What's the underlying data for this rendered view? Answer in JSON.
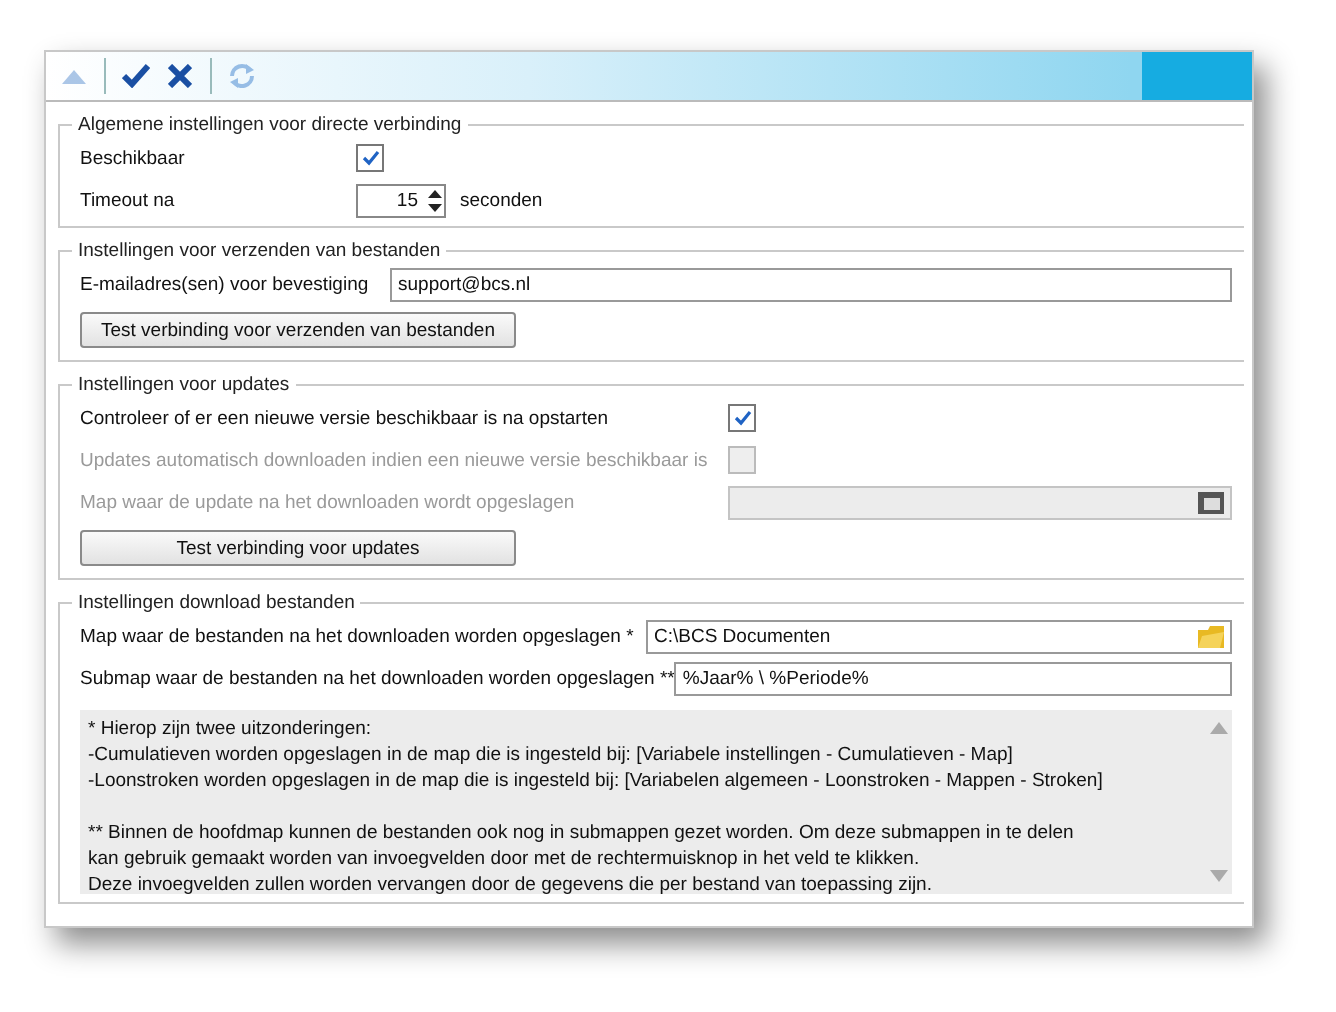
{
  "toolbar": {
    "buttons": [
      {
        "kind": "up",
        "disabled": true
      },
      {
        "kind": "save",
        "disabled": false
      },
      {
        "kind": "cancel",
        "disabled": false
      },
      {
        "kind": "refresh",
        "disabled": true
      }
    ]
  },
  "groups": [
    {
      "title": "Algemene instellingen voor directe verbinding",
      "rows": [
        {
          "kind": "checkbox",
          "label": "Beschikbaar",
          "checked": true,
          "disabled": false
        },
        {
          "kind": "spinner",
          "label": "Timeout na",
          "value": "15",
          "unit": "seconden"
        }
      ]
    },
    {
      "title": "Instellingen voor verzenden van bestanden",
      "rows": [
        {
          "kind": "text",
          "label": "E-mailadres(sen) voor bevestiging",
          "value": "support@bcs.nl",
          "disabled": false
        },
        {
          "kind": "button",
          "label": "Test verbinding voor verzenden van bestanden"
        }
      ]
    },
    {
      "title": "Instellingen voor updates",
      "rows": [
        {
          "kind": "checkbox",
          "label": "Controleer of er een nieuwe versie beschikbaar is na opstarten",
          "checked": true,
          "disabled": false
        },
        {
          "kind": "checkbox",
          "label": "Updates automatisch downloaden indien een nieuwe versie beschikbaar is",
          "checked": false,
          "disabled": true
        },
        {
          "kind": "folder",
          "label": "Map waar de update na het downloaden wordt opgeslagen",
          "value": "",
          "disabled": true
        },
        {
          "kind": "button",
          "label": "Test verbinding voor updates"
        }
      ]
    },
    {
      "title": "Instellingen download bestanden",
      "rows": [
        {
          "kind": "folder",
          "label": "Map waar de bestanden na het downloaden worden opgeslagen *",
          "value": "C:\\BCS Documenten",
          "disabled": false
        },
        {
          "kind": "text",
          "label": "Submap waar de bestanden na het downloaden worden opgeslagen **",
          "value": "%Jaar% \\ %Periode%",
          "disabled": false
        },
        {
          "kind": "notes",
          "paragraphs": [
            [
              "* Hierop zijn twee uitzonderingen:",
              "-Cumulatieven worden opgeslagen in de map die is ingesteld bij: [Variabele instellingen - Cumulatieven - Map]",
              "-Loonstroken worden opgeslagen in de map die is ingesteld bij: [Variabelen algemeen - Loonstroken - Mappen - Stroken]"
            ],
            [
              "** Binnen de hoofdmap kunnen de bestanden ook nog in submappen gezet worden. Om deze submappen in te delen",
              "kan gebruik gemaakt worden van invoegvelden door met de rechtermuisknop in het veld te klikken.",
              "Deze invoegvelden zullen worden vervangen door de gegevens die per bestand van toepassing zijn."
            ]
          ]
        }
      ]
    }
  ]
}
